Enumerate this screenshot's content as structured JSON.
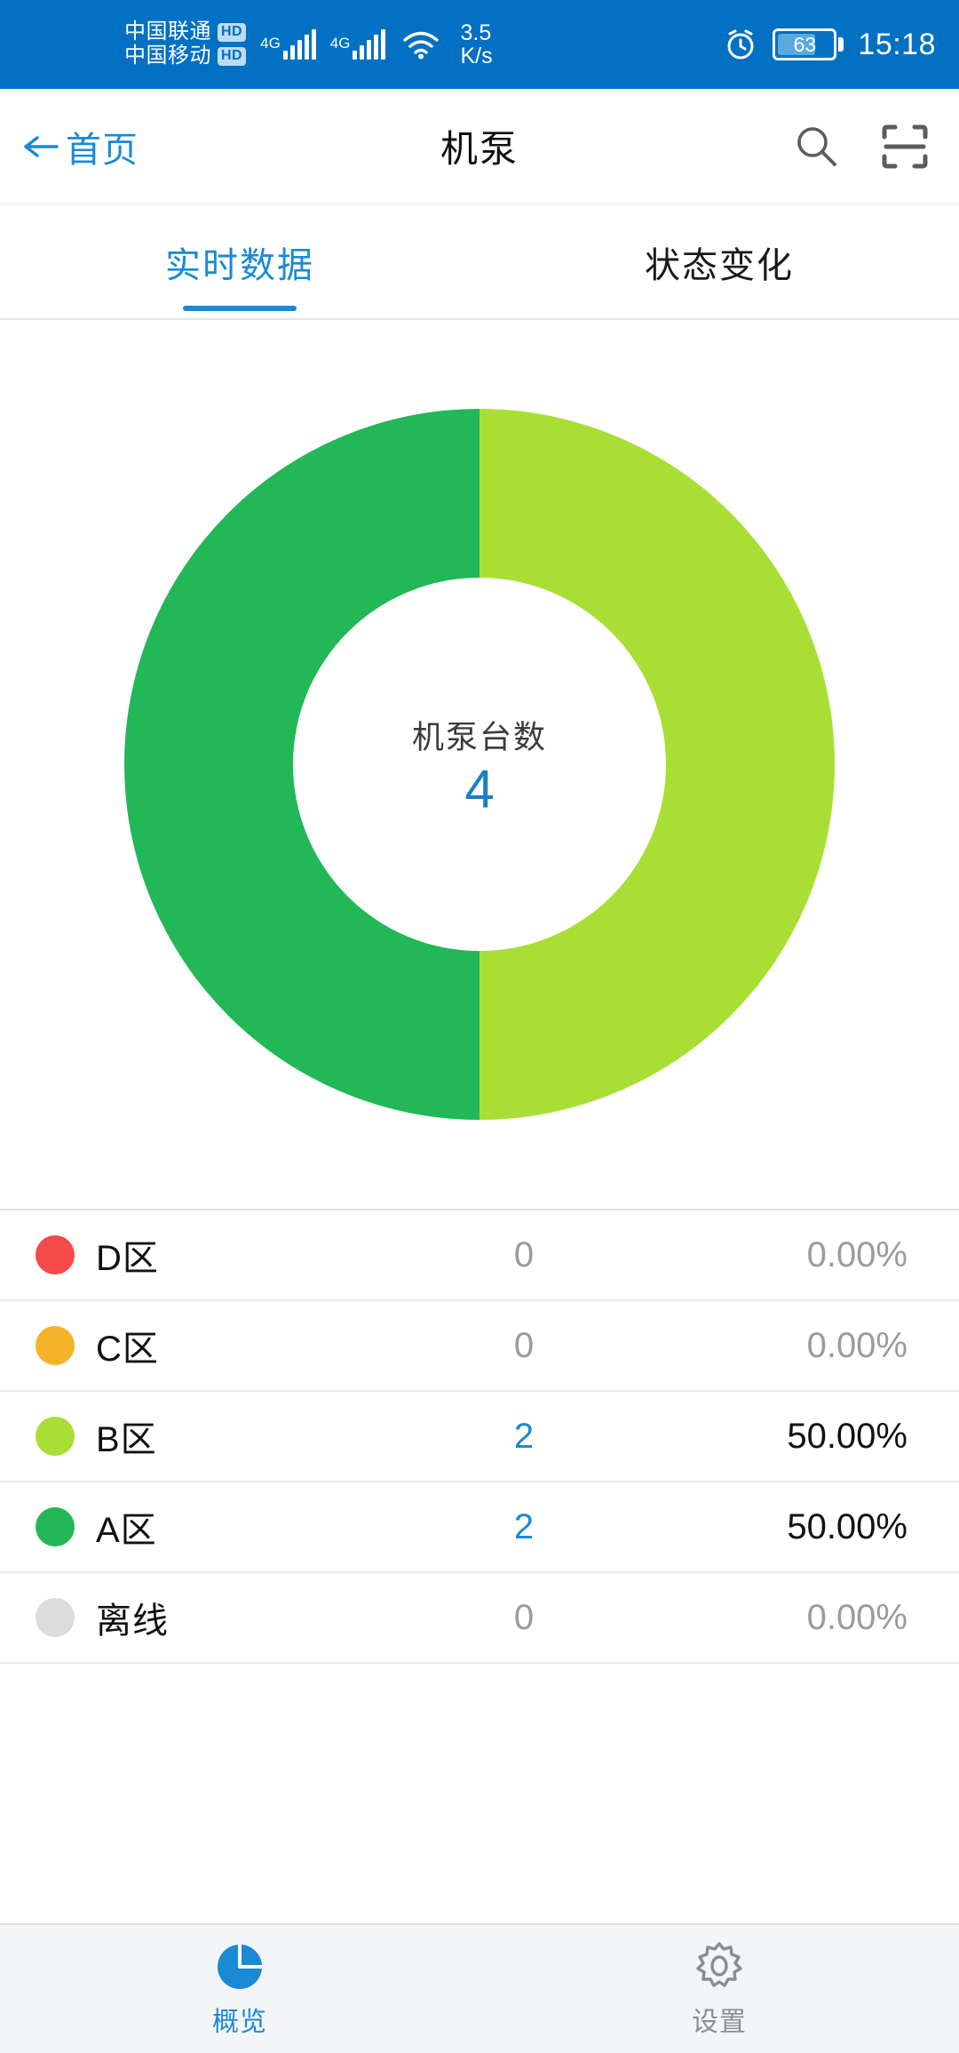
{
  "statusbar": {
    "carrier_primary": "中国联通",
    "carrier_primary_badge": "HD",
    "carrier_secondary": "中国移动",
    "carrier_secondary_badge": "HD",
    "network_primary": "4G",
    "network_secondary": "4G",
    "speed_value": "3.5",
    "speed_unit": "K/s",
    "battery_percent": "63",
    "time": "15:18",
    "alarm_icon": "alarm-clock-icon",
    "wifi_icon": "wifi-icon"
  },
  "header": {
    "back_label": "首页",
    "title": "机泵",
    "search_icon": "search-icon",
    "scan_icon": "scan-qr-icon"
  },
  "tabs": [
    {
      "label": "实时数据",
      "active": true
    },
    {
      "label": "状态变化",
      "active": false
    }
  ],
  "chart_data": {
    "type": "pie",
    "title": "机泵台数",
    "center_label": "机泵台数",
    "center_value": "4",
    "total": 4,
    "categories": [
      "B区",
      "A区"
    ],
    "values": [
      2,
      2
    ],
    "colors": [
      "#a9df35",
      "#22b757"
    ],
    "legend_position": "below-as-list",
    "donut": true,
    "inner_radius_ratio": 0.47,
    "start_angle_deg": 0,
    "series": [
      {
        "name": "B区",
        "value": 2,
        "percent": "50.00%",
        "color": "#a9df35"
      },
      {
        "name": "A区",
        "value": 2,
        "percent": "50.00%",
        "color": "#22b757"
      }
    ]
  },
  "list": {
    "rows": [
      {
        "name": "D区",
        "count": "0",
        "percent": "0.00%",
        "color": "#f5494a",
        "muted": true
      },
      {
        "name": "C区",
        "count": "0",
        "percent": "0.00%",
        "color": "#f5b427",
        "muted": true
      },
      {
        "name": "B区",
        "count": "2",
        "percent": "50.00%",
        "color": "#a9df35",
        "muted": false
      },
      {
        "name": "A区",
        "count": "2",
        "percent": "50.00%",
        "color": "#22b757",
        "muted": false
      },
      {
        "name": "离线",
        "count": "0",
        "percent": "0.00%",
        "color": "#dcdcdc",
        "muted": true
      }
    ]
  },
  "bottomnav": [
    {
      "label": "概览",
      "icon": "pie-chart-icon",
      "active": true
    },
    {
      "label": "设置",
      "icon": "gear-icon",
      "active": false
    }
  ],
  "colors": {
    "status_bar": "#0270c3",
    "accent": "#1a8ad4",
    "zone_a": "#22b757",
    "zone_b": "#a9df35",
    "zone_c": "#f5b427",
    "zone_d": "#f5494a",
    "offline": "#dcdcdc"
  }
}
